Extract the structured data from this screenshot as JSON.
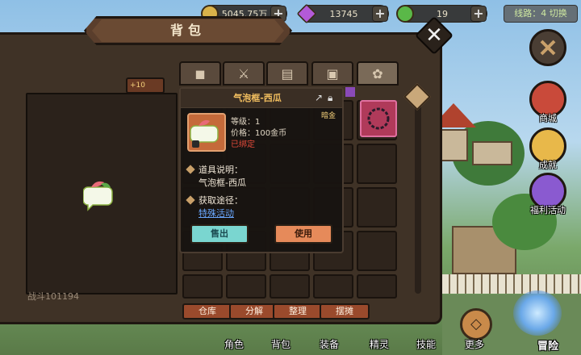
{
  "resources": {
    "gold": {
      "value": "5045.75万",
      "color": "#d9b24a"
    },
    "gems": {
      "value": "13745",
      "color": "#b35ad8"
    },
    "hearts": {
      "value": "19",
      "color": "#5ab848"
    },
    "line_switch": "线路：4 切换"
  },
  "panel": {
    "title": "背包",
    "power_partial": "战斗101194"
  },
  "tabs": [
    {
      "icon": "bread-icon",
      "glyph": "◼"
    },
    {
      "icon": "sword-icon",
      "glyph": "⚔"
    },
    {
      "icon": "book-icon",
      "glyph": "▤"
    },
    {
      "icon": "gift-icon",
      "glyph": "▣"
    },
    {
      "icon": "decor-icon",
      "glyph": "✿"
    }
  ],
  "tooltip": {
    "name": "气泡框-西瓜",
    "level": "等级：1",
    "price": "价格：100金币",
    "bound": "已绑定",
    "desc_title": "道具说明：",
    "desc": "气泡框-西瓜",
    "source_title": "获取途径：",
    "source_link": "特殊活动",
    "sell_label": "售出",
    "use_label": "使用",
    "tag": "暗金"
  },
  "bottom_buttons": {
    "warehouse": "仓库",
    "decompose": "分解",
    "organize": "整理",
    "stall": "摆摊"
  },
  "side_menu": {
    "shop": "商城",
    "achievement": "成就",
    "welfare": "福利活动"
  },
  "bottom_nav": {
    "role": "角色",
    "bag": "背包",
    "equip": "装备",
    "sprite": "精灵",
    "skill": "技能",
    "more": "更多",
    "adventure": "冒险"
  },
  "colors": {
    "panel_bg": "#3f3226",
    "accent_orange": "#e68a5a",
    "accent_teal": "#7ad6d0",
    "link": "#6aa8ff",
    "bound_red": "#e24a3a"
  }
}
